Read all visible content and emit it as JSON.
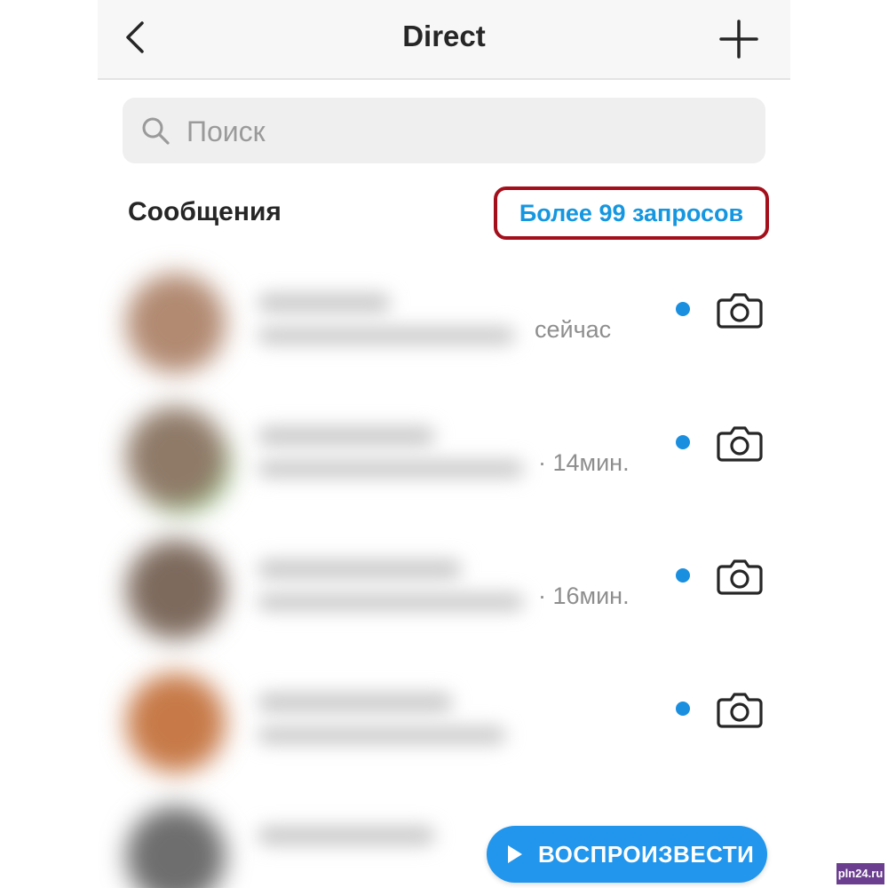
{
  "header": {
    "title": "Direct",
    "back_icon": "chevron-left-icon",
    "add_icon": "plus-icon"
  },
  "search": {
    "placeholder": "Поиск",
    "icon": "search-icon"
  },
  "messages": {
    "section_title": "Сообщения",
    "requests_link": "Более 99 запросов",
    "highlight_color": "#a3101c",
    "link_color": "#1596e0",
    "threads": [
      {
        "time": "сейчас",
        "unread": true,
        "action_icon": "camera-icon"
      },
      {
        "time": "· 14мин.",
        "unread": true,
        "action_icon": "camera-icon"
      },
      {
        "time": "· 16мин.",
        "unread": true,
        "action_icon": "camera-icon"
      },
      {
        "time": "",
        "unread": true,
        "action_icon": "camera-icon"
      }
    ]
  },
  "playback": {
    "label": "ВОСПРОИЗВЕСТИ",
    "icon": "play-icon",
    "color": "#2196ec"
  },
  "watermark": "pln24.ru"
}
